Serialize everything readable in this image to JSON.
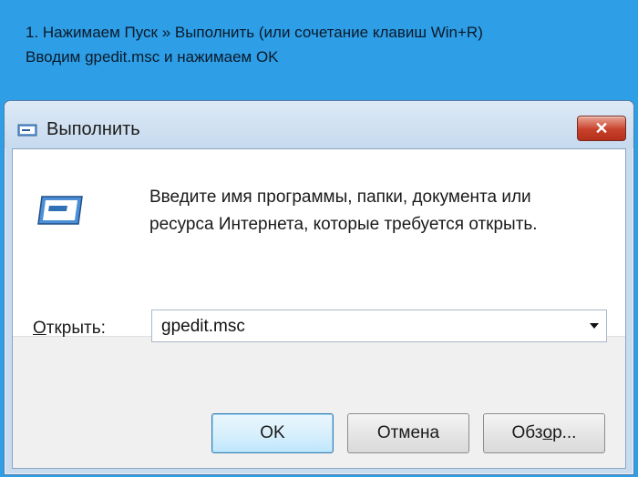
{
  "instructions": {
    "line1": "1.   Нажимаем Пуск » Выполнить (или сочетание клавиш Win+R)",
    "line2": "Вводим gpedit.msc и нажимаем OK"
  },
  "window": {
    "title": "Выполнить",
    "close_icon": "close-icon"
  },
  "dialog": {
    "description_line1": "Введите имя программы, папки, документа или",
    "description_line2": "ресурса Интернета, которые требуется открыть.",
    "open_label_underlined": "О",
    "open_label_rest": "ткрыть:",
    "open_value": "gpedit.msc"
  },
  "buttons": {
    "ok": "OK",
    "cancel": "Отмена",
    "browse_pre": "Обз",
    "browse_underlined": "о",
    "browse_post": "р..."
  },
  "colors": {
    "background": "#2e9ee6",
    "close_button": "#c7412b"
  }
}
